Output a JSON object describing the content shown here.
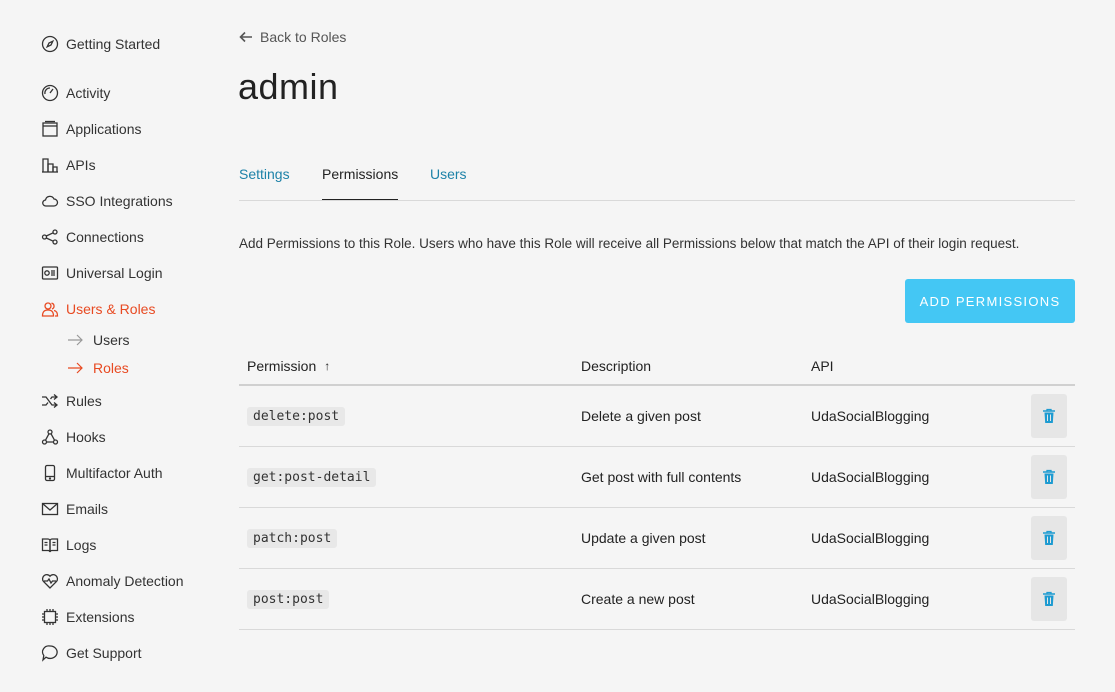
{
  "sidebar": {
    "items": [
      {
        "label": "Getting Started",
        "icon": "compass-icon"
      },
      {
        "label": "Activity",
        "icon": "gauge-icon"
      },
      {
        "label": "Applications",
        "icon": "window-icon"
      },
      {
        "label": "APIs",
        "icon": "building-icon"
      },
      {
        "label": "SSO Integrations",
        "icon": "cloud-icon"
      },
      {
        "label": "Connections",
        "icon": "share-icon"
      },
      {
        "label": "Universal Login",
        "icon": "login-icon"
      },
      {
        "label": "Users & Roles",
        "icon": "users-icon"
      },
      {
        "label": "Rules",
        "icon": "shuffle-icon"
      },
      {
        "label": "Hooks",
        "icon": "hooks-icon"
      },
      {
        "label": "Multifactor Auth",
        "icon": "phone-icon"
      },
      {
        "label": "Emails",
        "icon": "mail-icon"
      },
      {
        "label": "Logs",
        "icon": "book-icon"
      },
      {
        "label": "Anomaly Detection",
        "icon": "heart-pulse-icon"
      },
      {
        "label": "Extensions",
        "icon": "chip-icon"
      },
      {
        "label": "Get Support",
        "icon": "chat-icon"
      }
    ],
    "subitems": [
      {
        "label": "Users"
      },
      {
        "label": "Roles"
      }
    ],
    "active_color": "#e84a22"
  },
  "header": {
    "back_label": "Back to Roles",
    "title": "admin"
  },
  "tabs": [
    {
      "label": "Settings"
    },
    {
      "label": "Permissions"
    },
    {
      "label": "Users"
    }
  ],
  "intro_text": "Add Permissions to this Role. Users who have this Role will receive all Permissions below that match the API of their login request.",
  "add_button_label": "ADD PERMISSIONS",
  "table": {
    "columns": [
      "Permission",
      "Description",
      "API"
    ],
    "sort_indicator": "↑",
    "rows": [
      {
        "permission": "delete:post",
        "description": "Delete a given post",
        "api": "UdaSocialBlogging"
      },
      {
        "permission": "get:post-detail",
        "description": "Get post with full contents",
        "api": "UdaSocialBlogging"
      },
      {
        "permission": "patch:post",
        "description": "Update a given post",
        "api": "UdaSocialBlogging"
      },
      {
        "permission": "post:post",
        "description": "Create a new post",
        "api": "UdaSocialBlogging"
      }
    ]
  },
  "colors": {
    "accent": "#44c7f4",
    "link": "#1d82a8",
    "trash": "#1d9bd1"
  }
}
